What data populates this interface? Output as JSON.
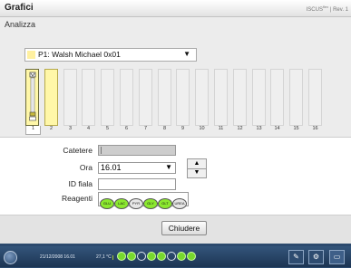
{
  "window": {
    "title": "Grafici",
    "brand": "ISCUS",
    "brand_sup": "flex",
    "brand_tail": "| Rev. 1",
    "subtitle": "Analizza"
  },
  "patient_select": {
    "value": "P1: Walsh Michael 0x01",
    "swatch_color": "#fff0a0"
  },
  "slots": {
    "numbers": [
      "1",
      "2",
      "3",
      "4",
      "5",
      "6",
      "7",
      "8",
      "9",
      "10",
      "11",
      "12",
      "13",
      "14",
      "15",
      "16"
    ],
    "selected": "1",
    "filled": [
      "1",
      "2"
    ],
    "filled_color": "#fff7a8"
  },
  "form": {
    "catetere_label": "Catetere",
    "catetere_value": "",
    "ora_label": "Ora",
    "ora_value": "16.01",
    "id_label": "ID fiala",
    "id_value": "",
    "reagenti_label": "Reagenti",
    "reagents": [
      {
        "code": "GLU",
        "active": true
      },
      {
        "code": "LAC",
        "active": true
      },
      {
        "code": "PYR",
        "active": false
      },
      {
        "code": "GLY",
        "active": true
      },
      {
        "code": "GLT",
        "active": true
      },
      {
        "code": "UREA",
        "active": false
      }
    ],
    "active_color": "#8be82f"
  },
  "footer": {
    "close_label": "Chiudere"
  },
  "taskbar": {
    "datetime": "21/12/2008 16.01",
    "temperature": "27,1 °C",
    "status_icons": [
      {
        "name": "status-green-1-icon",
        "state": "green"
      },
      {
        "name": "status-green-2-icon",
        "state": "green"
      },
      {
        "name": "status-white-1-icon",
        "state": "white"
      },
      {
        "name": "status-green-3-icon",
        "state": "green"
      },
      {
        "name": "status-green-4-icon",
        "state": "green"
      },
      {
        "name": "status-white-2-icon",
        "state": "white"
      },
      {
        "name": "status-green-5-icon",
        "state": "green"
      },
      {
        "name": "status-green-6-icon",
        "state": "green"
      }
    ],
    "buttons": [
      {
        "name": "vial-icon",
        "glyph": "✎"
      },
      {
        "name": "gear-icon",
        "glyph": "⚙"
      },
      {
        "name": "chart-icon",
        "glyph": "▭"
      }
    ]
  }
}
